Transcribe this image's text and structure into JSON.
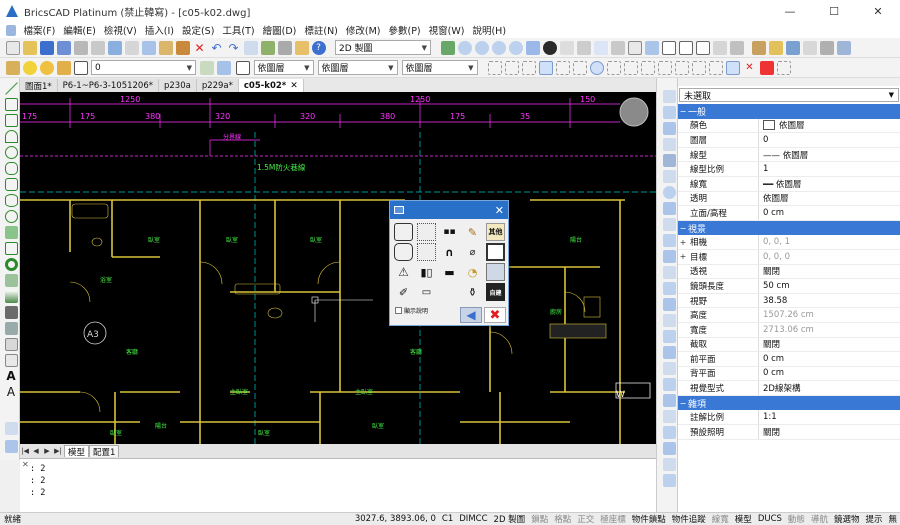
{
  "window": {
    "title": "BricsCAD Platinum (禁止韓寫) - [c05-k02.dwg]",
    "minimize": "—",
    "maximize": "☐",
    "close": "✕"
  },
  "menu": [
    "檔案(F)",
    "編輯(E)",
    "檢視(V)",
    "插入(I)",
    "設定(S)",
    "工具(T)",
    "繪圖(D)",
    "標註(N)",
    "修改(M)",
    "參數(P)",
    "視窗(W)",
    "說明(H)"
  ],
  "toolbar": {
    "visual_style": "2D 製圖",
    "layer_number": "0",
    "color": "依圖層",
    "linetype": "依圖層",
    "lineweight": "依圖層"
  },
  "doc_tabs": [
    {
      "label": "圖面1*"
    },
    {
      "label": "P6-1~P6-3-1051206*"
    },
    {
      "label": "p230a"
    },
    {
      "label": "p229a*"
    },
    {
      "label": "c05-k02*",
      "active": true
    }
  ],
  "drawing": {
    "top_dims": [
      "1250",
      "1250",
      "150"
    ],
    "sub_dims": [
      "175",
      "175",
      "380",
      "320",
      "320",
      "380",
      "175",
      "35"
    ],
    "labels": {
      "plan_note": "1.5M防火巷線",
      "small_note": "分界線",
      "grid_a3": "A3",
      "corner_w": "W",
      "rooms": [
        "臥室",
        "臥室",
        "臥室",
        "臥室",
        "陽台",
        "客廳",
        "客廳",
        "主臥室",
        "主臥室",
        "臥室",
        "陽台",
        "臥室",
        "臥室",
        "廚房",
        "浴室"
      ]
    }
  },
  "dialog": {
    "check_label": "顯示說明",
    "back": "◀",
    "cancel": "✖",
    "close": "✕",
    "grid_labels": [
      "",
      "",
      "",
      "",
      "其他",
      "",
      "",
      "",
      "",
      "",
      "",
      "",
      "",
      "",
      "",
      "",
      "",
      "",
      "",
      "自建"
    ]
  },
  "layout_tabs": [
    "模型",
    "配置1"
  ],
  "command_lines": [
    ": 2",
    ": 2",
    ": 2"
  ],
  "properties": {
    "header": "未選取",
    "sections": [
      {
        "title": "一般",
        "rows": [
          {
            "name": "顏色",
            "value": "依圖層",
            "swatch": true
          },
          {
            "name": "圖層",
            "value": "0"
          },
          {
            "name": "線型",
            "value": "—— 依圖層"
          },
          {
            "name": "線型比例",
            "value": "1"
          },
          {
            "name": "線寬",
            "value": "━━ 依圖層"
          },
          {
            "name": "透明",
            "value": "依圖層"
          },
          {
            "name": "立面/高程",
            "value": "0 cm"
          }
        ]
      },
      {
        "title": "視景",
        "rows": [
          {
            "name": "相機",
            "value": "0, 0, 1",
            "exp": "+",
            "gray": true
          },
          {
            "name": "目標",
            "value": "0, 0, 0",
            "exp": "+",
            "gray": true
          },
          {
            "name": "透視",
            "value": "關閉"
          },
          {
            "name": "鏡頭長度",
            "value": "50 cm"
          },
          {
            "name": "視野",
            "value": "38.58"
          },
          {
            "name": "高度",
            "value": "1507.26 cm",
            "gray": true
          },
          {
            "name": "寬度",
            "value": "2713.06 cm",
            "gray": true
          },
          {
            "name": "截取",
            "value": "關閉"
          },
          {
            "name": "前平面",
            "value": "0 cm"
          },
          {
            "name": "背平面",
            "value": "0 cm"
          },
          {
            "name": "視覺型式",
            "value": "2D線架構"
          }
        ]
      },
      {
        "title": "雜項",
        "rows": [
          {
            "name": "註解比例",
            "value": "1:1"
          },
          {
            "name": "預設照明",
            "value": "關閉"
          }
        ]
      }
    ]
  },
  "status": {
    "left": "就緒",
    "coords": "3027.6, 3893.06, 0",
    "items": [
      {
        "label": "C1",
        "on": true
      },
      {
        "label": "DIMCC",
        "on": true
      },
      {
        "label": "2D 製圖",
        "on": true
      },
      {
        "label": "鎖點",
        "on": false
      },
      {
        "label": "格點",
        "on": false
      },
      {
        "label": "正交",
        "on": false
      },
      {
        "label": "極座標",
        "on": false
      },
      {
        "label": "物件鎖點",
        "on": true
      },
      {
        "label": "物件追蹤",
        "on": true
      },
      {
        "label": "線寬",
        "on": false
      },
      {
        "label": "模型",
        "on": true
      },
      {
        "label": "DUCS",
        "on": true
      },
      {
        "label": "動態",
        "on": false
      },
      {
        "label": "導航",
        "on": false
      },
      {
        "label": "鏡選物",
        "on": true
      },
      {
        "label": "提示",
        "on": true
      },
      {
        "label": "無",
        "on": true
      }
    ]
  },
  "colors": {
    "canvas": "#000000",
    "wall": "#d8c23a",
    "dim": "#ff33ff",
    "text_green": "#44ee44",
    "accent": "#3a78d6"
  }
}
